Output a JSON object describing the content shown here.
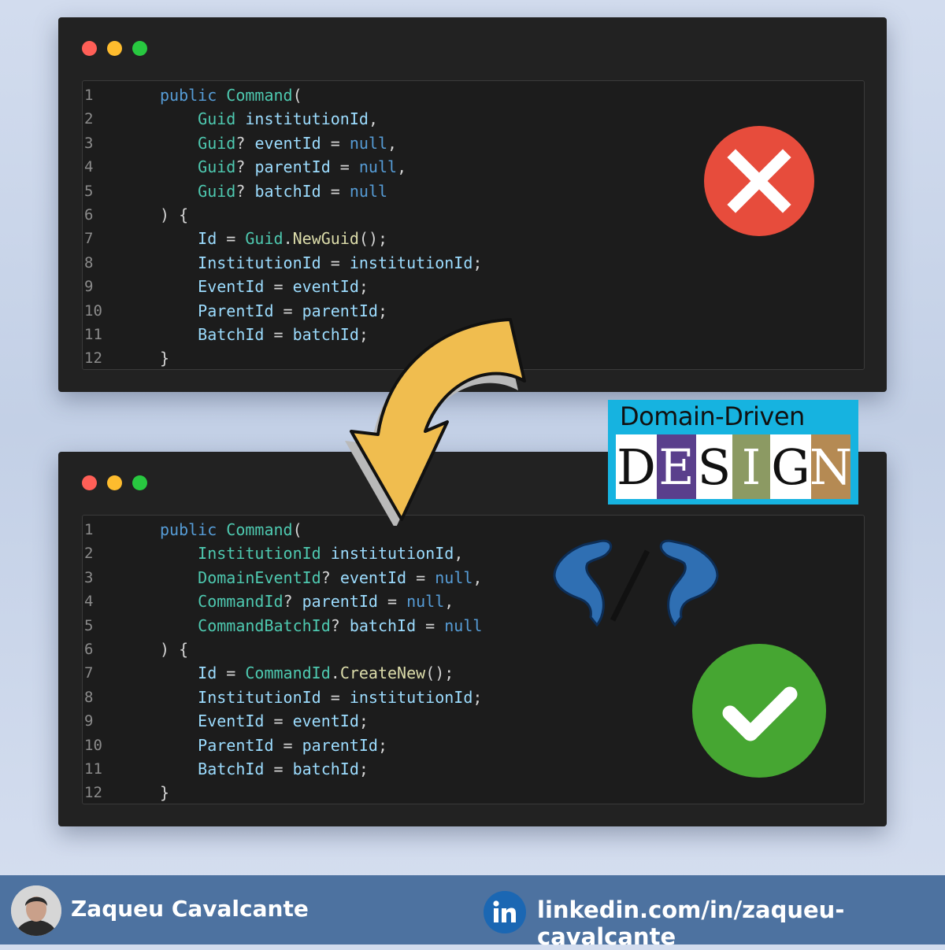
{
  "before_code": [
    [
      [
        "kw",
        "public"
      ],
      [
        "pn",
        " "
      ],
      [
        "ty",
        "Command"
      ],
      [
        "pn",
        "("
      ]
    ],
    [
      [
        "pn",
        "    "
      ],
      [
        "ty",
        "Guid"
      ],
      [
        "pn",
        " "
      ],
      [
        "id",
        "institutionId"
      ],
      [
        "pn",
        ","
      ]
    ],
    [
      [
        "pn",
        "    "
      ],
      [
        "ty",
        "Guid"
      ],
      [
        "pn",
        "? "
      ],
      [
        "id",
        "eventId"
      ],
      [
        "pn",
        " = "
      ],
      [
        "kw",
        "null"
      ],
      [
        "pn",
        ","
      ]
    ],
    [
      [
        "pn",
        "    "
      ],
      [
        "ty",
        "Guid"
      ],
      [
        "pn",
        "? "
      ],
      [
        "id",
        "parentId"
      ],
      [
        "pn",
        " = "
      ],
      [
        "kw",
        "null"
      ],
      [
        "pn",
        ","
      ]
    ],
    [
      [
        "pn",
        "    "
      ],
      [
        "ty",
        "Guid"
      ],
      [
        "pn",
        "? "
      ],
      [
        "id",
        "batchId"
      ],
      [
        "pn",
        " = "
      ],
      [
        "kw",
        "null"
      ]
    ],
    [
      [
        "pn",
        ") {"
      ]
    ],
    [
      [
        "pn",
        "    "
      ],
      [
        "id",
        "Id"
      ],
      [
        "pn",
        " = "
      ],
      [
        "ty",
        "Guid"
      ],
      [
        "pn",
        "."
      ],
      [
        "fn",
        "NewGuid"
      ],
      [
        "pn",
        "();"
      ]
    ],
    [
      [
        "pn",
        "    "
      ],
      [
        "id",
        "InstitutionId"
      ],
      [
        "pn",
        " = "
      ],
      [
        "id",
        "institutionId"
      ],
      [
        "pn",
        ";"
      ]
    ],
    [
      [
        "pn",
        "    "
      ],
      [
        "id",
        "EventId"
      ],
      [
        "pn",
        " = "
      ],
      [
        "id",
        "eventId"
      ],
      [
        "pn",
        ";"
      ]
    ],
    [
      [
        "pn",
        "    "
      ],
      [
        "id",
        "ParentId"
      ],
      [
        "pn",
        " = "
      ],
      [
        "id",
        "parentId"
      ],
      [
        "pn",
        ";"
      ]
    ],
    [
      [
        "pn",
        "    "
      ],
      [
        "id",
        "BatchId"
      ],
      [
        "pn",
        " = "
      ],
      [
        "id",
        "batchId"
      ],
      [
        "pn",
        ";"
      ]
    ],
    [
      [
        "pn",
        "}"
      ]
    ]
  ],
  "after_code": [
    [
      [
        "kw",
        "public"
      ],
      [
        "pn",
        " "
      ],
      [
        "ty",
        "Command"
      ],
      [
        "pn",
        "("
      ]
    ],
    [
      [
        "pn",
        "    "
      ],
      [
        "ty",
        "InstitutionId"
      ],
      [
        "pn",
        " "
      ],
      [
        "id",
        "institutionId"
      ],
      [
        "pn",
        ","
      ]
    ],
    [
      [
        "pn",
        "    "
      ],
      [
        "ty",
        "DomainEventId"
      ],
      [
        "pn",
        "? "
      ],
      [
        "id",
        "eventId"
      ],
      [
        "pn",
        " = "
      ],
      [
        "kw",
        "null"
      ],
      [
        "pn",
        ","
      ]
    ],
    [
      [
        "pn",
        "    "
      ],
      [
        "ty",
        "CommandId"
      ],
      [
        "pn",
        "? "
      ],
      [
        "id",
        "parentId"
      ],
      [
        "pn",
        " = "
      ],
      [
        "kw",
        "null"
      ],
      [
        "pn",
        ","
      ]
    ],
    [
      [
        "pn",
        "    "
      ],
      [
        "ty",
        "CommandBatchId"
      ],
      [
        "pn",
        "? "
      ],
      [
        "id",
        "batchId"
      ],
      [
        "pn",
        " = "
      ],
      [
        "kw",
        "null"
      ]
    ],
    [
      [
        "pn",
        ") {"
      ]
    ],
    [
      [
        "pn",
        "    "
      ],
      [
        "id",
        "Id"
      ],
      [
        "pn",
        " = "
      ],
      [
        "ty",
        "CommandId"
      ],
      [
        "pn",
        "."
      ],
      [
        "fn",
        "CreateNew"
      ],
      [
        "pn",
        "();"
      ]
    ],
    [
      [
        "pn",
        "    "
      ],
      [
        "id",
        "InstitutionId"
      ],
      [
        "pn",
        " = "
      ],
      [
        "id",
        "institutionId"
      ],
      [
        "pn",
        ";"
      ]
    ],
    [
      [
        "pn",
        "    "
      ],
      [
        "id",
        "EventId"
      ],
      [
        "pn",
        " = "
      ],
      [
        "id",
        "eventId"
      ],
      [
        "pn",
        ";"
      ]
    ],
    [
      [
        "pn",
        "    "
      ],
      [
        "id",
        "ParentId"
      ],
      [
        "pn",
        " = "
      ],
      [
        "id",
        "parentId"
      ],
      [
        "pn",
        ";"
      ]
    ],
    [
      [
        "pn",
        "    "
      ],
      [
        "id",
        "BatchId"
      ],
      [
        "pn",
        " = "
      ],
      [
        "id",
        "batchId"
      ],
      [
        "pn",
        ";"
      ]
    ],
    [
      [
        "pn",
        "}"
      ]
    ]
  ],
  "ddd_logo": {
    "top": "Domain-Driven",
    "letters": [
      {
        "ch": "D",
        "bg": "#ffffff",
        "fg": "#111111"
      },
      {
        "ch": "E",
        "bg": "#5a3f8c",
        "fg": "#ffffff"
      },
      {
        "ch": "S",
        "bg": "#ffffff",
        "fg": "#111111"
      },
      {
        "ch": "I",
        "bg": "#8c9a63",
        "fg": "#ffffff"
      },
      {
        "ch": "G",
        "bg": "#ffffff",
        "fg": "#111111"
      },
      {
        "ch": "N",
        "bg": "#b58a53",
        "fg": "#ffffff"
      }
    ]
  },
  "colors": {
    "keyword": "#569cd6",
    "type": "#4ec9b0",
    "identifier": "#9cdcfe",
    "method": "#dcdcaa",
    "bad": "#e74c3c",
    "good": "#46a632",
    "arrow": "#f0bd4f"
  },
  "footer": {
    "name": "Zaqueu Cavalcante",
    "linkedin": "linkedin.com/in/zaqueu-cavalcante"
  },
  "icons": [
    "close-icon",
    "check-icon",
    "curved-arrow-icon",
    "flexing-arms-code-icon",
    "linkedin-icon"
  ]
}
